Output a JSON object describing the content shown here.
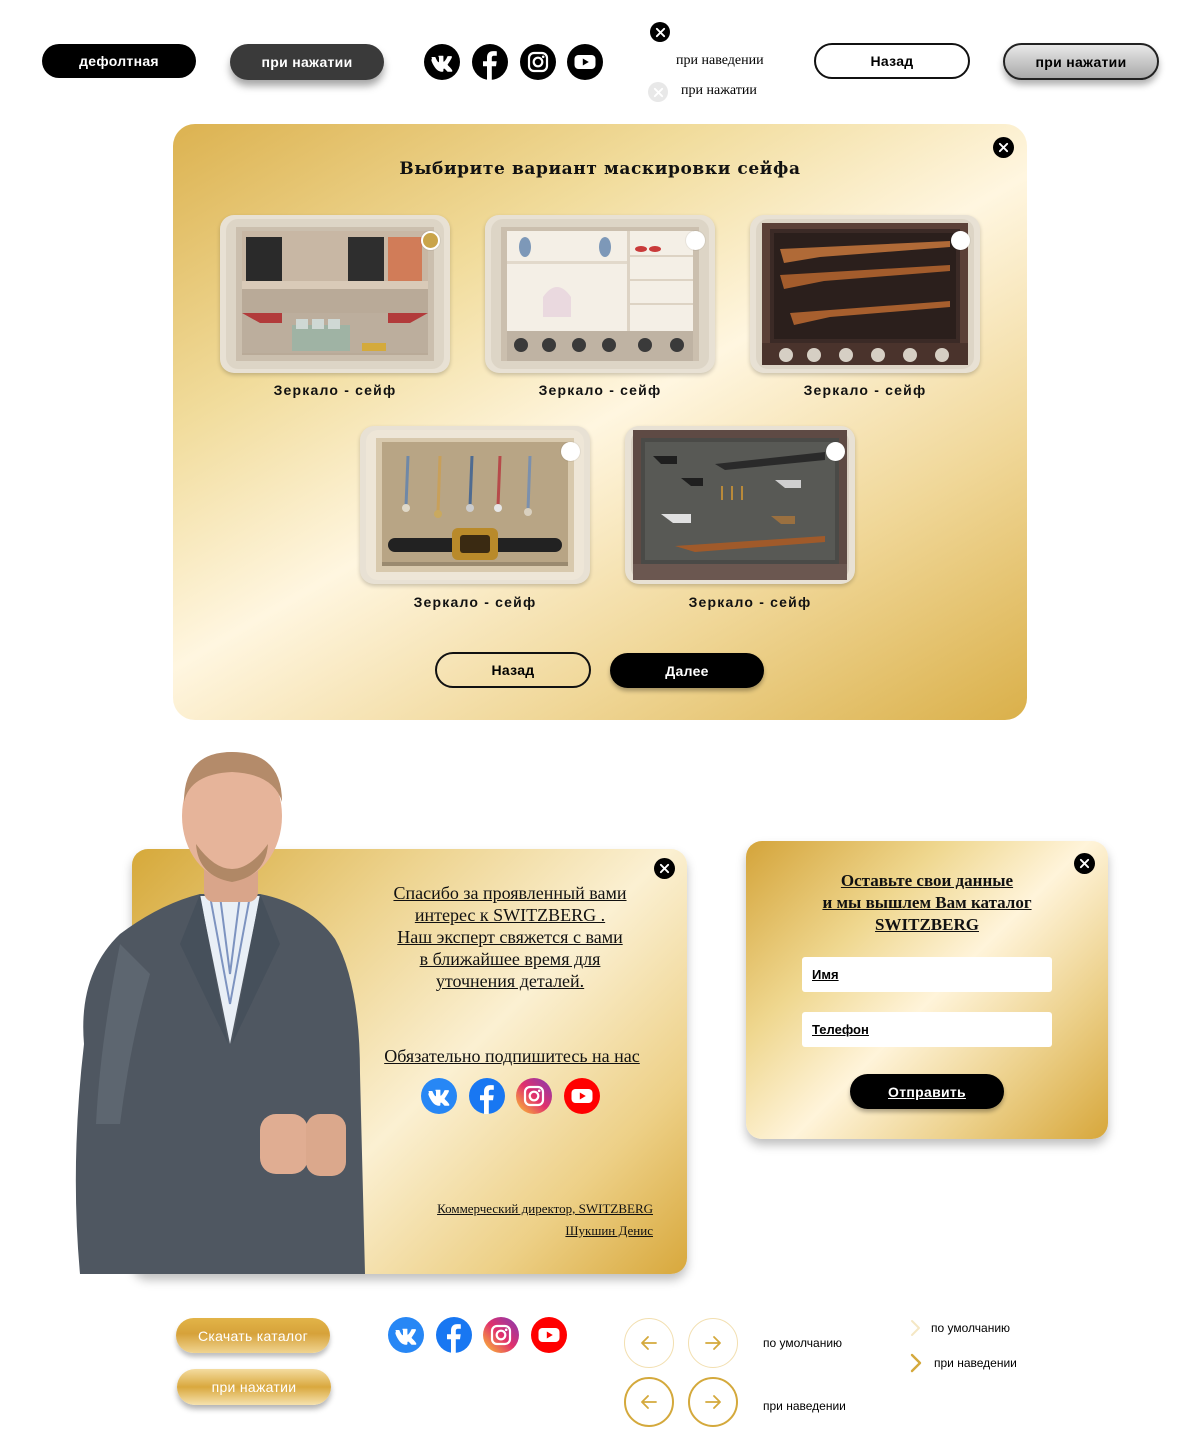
{
  "top_row": {
    "default_button": "дефолтная",
    "pressed_button": "при нажатии",
    "social_icons": [
      "vk-icon",
      "facebook-icon",
      "instagram-icon",
      "youtube-icon"
    ],
    "close_states": {
      "hover_label": "при наведении",
      "pressed_label": "при нажатии"
    },
    "back_button": "Назад",
    "back_pressed_button": "при нажатии"
  },
  "camouflage_modal": {
    "title": "Выбирите вариант маскировки сейфа",
    "options": [
      {
        "caption": "Зеркало - сейф",
        "selected": true
      },
      {
        "caption": "Зеркало - сейф",
        "selected": false
      },
      {
        "caption": "Зеркало - сейф",
        "selected": false
      },
      {
        "caption": "Зеркало - сейф",
        "selected": false
      },
      {
        "caption": "Зеркало - сейф",
        "selected": false
      }
    ],
    "back_button": "Назад",
    "next_button": "Далее"
  },
  "thanks_modal": {
    "message_lines": [
      "Спасибо за проявленный вами",
      "интерес к SWITZBERG .",
      "Наш эксперт свяжется с вами",
      "в ближайшее время для",
      "уточнения деталей."
    ],
    "subscribe": "Обязательно подпишитесь на нас",
    "signature_title": "Коммерческий директор, SWITZBERG",
    "signature_name": "Шукшин Денис"
  },
  "catalog_modal": {
    "heading_lines": [
      "Оставьте свои данные",
      "и мы вышлем Вам каталог",
      "SWITZBERG"
    ],
    "name_placeholder": "Имя",
    "phone_placeholder": "Телефон",
    "submit_button": "Отправить"
  },
  "bottom_row": {
    "download_button": "Скачать каталог",
    "download_pressed": "при нажатии",
    "arrows_default_label": "по умолчанию",
    "arrows_hover_label": "при наведении",
    "chevron_default_label": "по умолчанию",
    "chevron_hover_label": "при наведении"
  },
  "colors": {
    "gold": "#d4a93c",
    "gold_light": "#fbf0d2",
    "black": "#000000",
    "vk_blue": "#2787f5",
    "facebook_blue": "#1877f2",
    "youtube_red": "#ff0000"
  }
}
